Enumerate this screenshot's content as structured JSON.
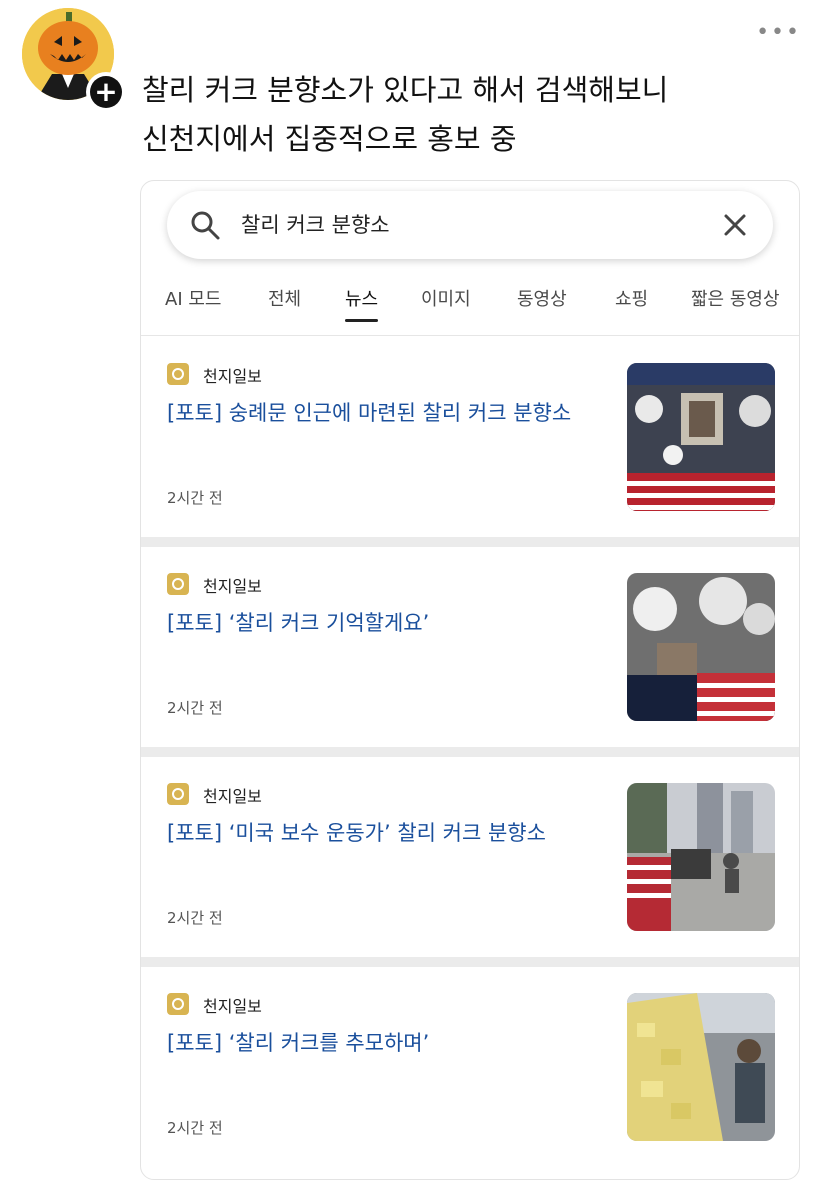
{
  "post": {
    "text_line1": "찰리 커크 분향소가 있다고 해서 검색해보니",
    "text_line2": "신천지에서 집중적으로 홍보 중",
    "follow_label": "+",
    "more_label": "•••"
  },
  "search": {
    "query": "찰리 커크 분향소"
  },
  "tabs": [
    {
      "label": "AI 모드"
    },
    {
      "label": "전체"
    },
    {
      "label": "뉴스",
      "active": true
    },
    {
      "label": "이미지"
    },
    {
      "label": "동영상"
    },
    {
      "label": "쇼핑"
    },
    {
      "label": "짧은 동영상"
    }
  ],
  "results": [
    {
      "source": "천지일보",
      "title": "[포토] 숭례문 인근에 마련된 찰리 커크 분향소",
      "time": "2시간 전"
    },
    {
      "source": "천지일보",
      "title": "[포토] ‘찰리 커크 기억할게요’",
      "time": "2시간 전"
    },
    {
      "source": "천지일보",
      "title": "[포토] ‘미국 보수 운동가’ 찰리 커크 분향소",
      "time": "2시간 전"
    },
    {
      "source": "천지일보",
      "title": "[포토] ‘찰리 커크를 추모하며’",
      "time": "2시간 전"
    }
  ],
  "colors": {
    "headline": "#1a4f9c",
    "source_logo": "#d8b452",
    "avatar_bg": "#f2c94c",
    "pumpkin": "#e8801f"
  }
}
